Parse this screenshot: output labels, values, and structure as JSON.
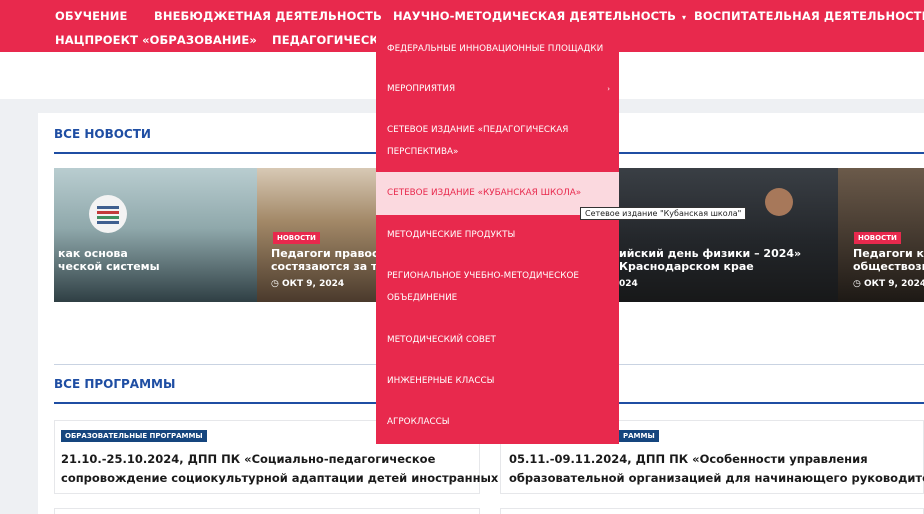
{
  "nav": {
    "items": [
      {
        "label": "ОБУЧЕНИЕ"
      },
      {
        "label": "ВНЕБЮДЖЕТНАЯ ДЕЯТЕЛЬНОСТЬ"
      },
      {
        "label": "НАУЧНО-МЕТОДИЧЕСКАЯ ДЕЯТЕЛЬНОСТЬ",
        "caret": "▾"
      },
      {
        "label": "ВОСПИТАТЕЛЬНАЯ ДЕЯТЕЛЬНОСТЬ"
      },
      {
        "label": "НАЦПРОЕКТ «ОБРАЗОВАНИЕ»"
      },
      {
        "label": "ПЕДАГОГИЧЕСКИ"
      }
    ]
  },
  "news": {
    "title": "ВСЕ НОВОСТИ",
    "slides": [
      {
        "title_line1": "как основа",
        "title_line2": "ческой системы"
      },
      {
        "badge": "НОВОСТИ",
        "title_line1": "Педагоги правос",
        "title_line2": "состязаются за ти",
        "date": "ОКТ 9, 2024"
      },
      {
        "title_line1": "ийский день физики – 2024»",
        "title_line2": "Краснодарском крае",
        "date": "024"
      },
      {
        "badge": "НОВОСТИ",
        "title_line1": "Педагоги кр",
        "title_line2": "обществозн",
        "date": "ОКТ 9, 2024"
      }
    ]
  },
  "programs": {
    "title": "ВСЕ ПРОГРАММЫ",
    "cards": [
      {
        "badge": "ОБРАЗОВАТЕЛЬНЫЕ ПРОГРАММЫ",
        "line1": "21.10.-25.10.2024, ДПП ПК «Социально-педагогическое",
        "line2": "сопровождение социокультурной адаптации детей иностранных"
      },
      {
        "badge": "РАММЫ",
        "line1": "05.11.-09.11.2024, ДПП ПК «Особенности управления",
        "line2": "образовательной организацией для начинающего руководителя»"
      }
    ]
  },
  "dropdown": {
    "items": [
      {
        "label": "Федеральные инновационные площадки"
      },
      {
        "label": "Мероприятия",
        "arrow": "›"
      },
      {
        "label": "Сетевое издание «Педагогическая",
        "label2": "перспектива»"
      },
      {
        "label": "Сетевое издание «Кубанская школа»"
      },
      {
        "label": "Методические продукты"
      },
      {
        "label": "Региональное учебно-методическое",
        "label2": "объединение"
      },
      {
        "label": "Методический совет"
      },
      {
        "label": "Инженерные классы"
      },
      {
        "label": "Агроклассы"
      }
    ]
  },
  "tooltip": "Сетевое издание \"Кубанская школа\"",
  "colors": {
    "accent": "#e8294d",
    "brand_blue": "#1f4ea3",
    "badge_blue": "#15457e"
  }
}
